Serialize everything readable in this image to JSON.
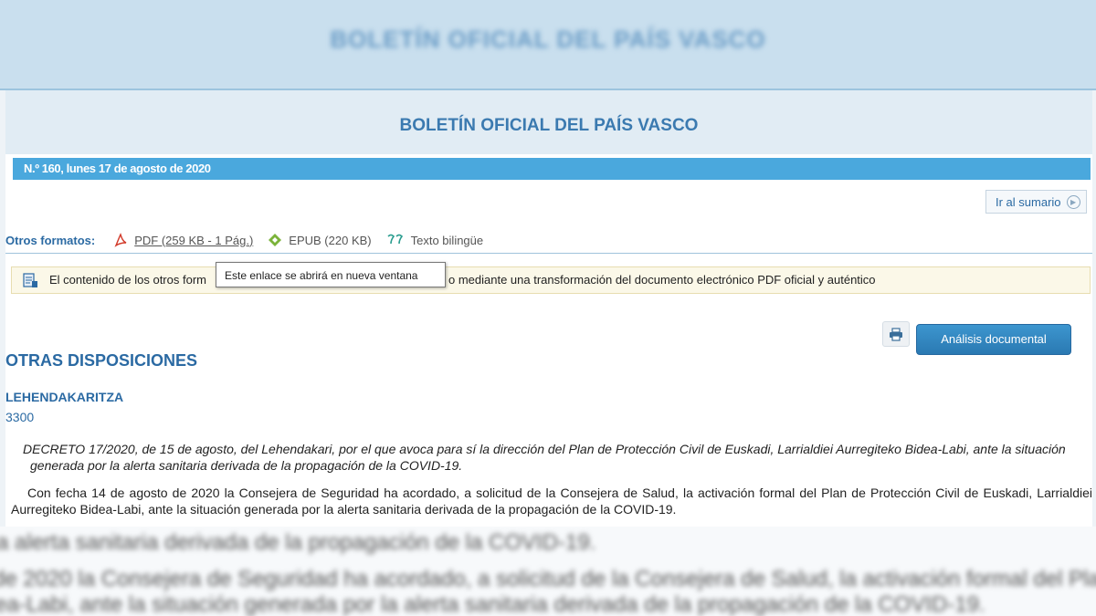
{
  "top_banner": {
    "title": "BOLETÍN OFICIAL DEL PAÍS VASCO"
  },
  "header": {
    "title": "BOLETÍN OFICIAL DEL PAÍS VASCO"
  },
  "issue": {
    "label": "N.º 160, lunes 17 de agosto de 2020"
  },
  "nav": {
    "sumario_label": "Ir al sumario"
  },
  "formats": {
    "label": "Otros formatos:",
    "items": [
      {
        "icon": "pdf-icon",
        "label": "PDF (259 KB - 1 Pág.)"
      },
      {
        "icon": "epub-icon",
        "label": "EPUB (220 KB)"
      },
      {
        "icon": "bilingual-icon",
        "label": "Texto bilingüe"
      }
    ]
  },
  "notice": {
    "text_start": "El contenido de los otros form",
    "text_end": "o mediante una transformación del documento electrónico PDF oficial y auténtico"
  },
  "tooltip": {
    "text": "Este enlace se abrirá en nueva ventana"
  },
  "actions": {
    "analysis_label": "Análisis documental"
  },
  "section": {
    "title": "OTRAS DISPOSICIONES",
    "department": "LEHENDAKARITZA",
    "number": "3300"
  },
  "decree": {
    "title": "DECRETO 17/2020, de 15 de agosto, del Lehendakari, por el que avoca para sí la dirección del Plan de Protección Civil de Euskadi, Larrialdiei Aurregiteko Bidea-Labi, ante la situación generada por la alerta sanitaria derivada de la propagación de la COVID-19.",
    "body": "Con fecha 14 de agosto de 2020 la Consejera de Seguridad ha acordado, a solicitud de la Consejera de Salud, la activación formal del Plan de Protección Civil de Euskadi, Larrialdiei Aurregiteko Bidea-Labi, ante la situación generada por la alerta sanitaria derivada de la propagación de la COVID-19."
  },
  "bottom_blur": {
    "line1": "a alerta sanitaria derivada de la propagación de la COVID-19.",
    "line2": "de 2020 la Consejera de Seguridad ha acordado, a solicitud de la Consejera de Salud, la activación formal del Plan de P",
    "line3": "ea-Labi, ante la situación generada por la alerta sanitaria derivada de la propagación de la COVID-19."
  }
}
